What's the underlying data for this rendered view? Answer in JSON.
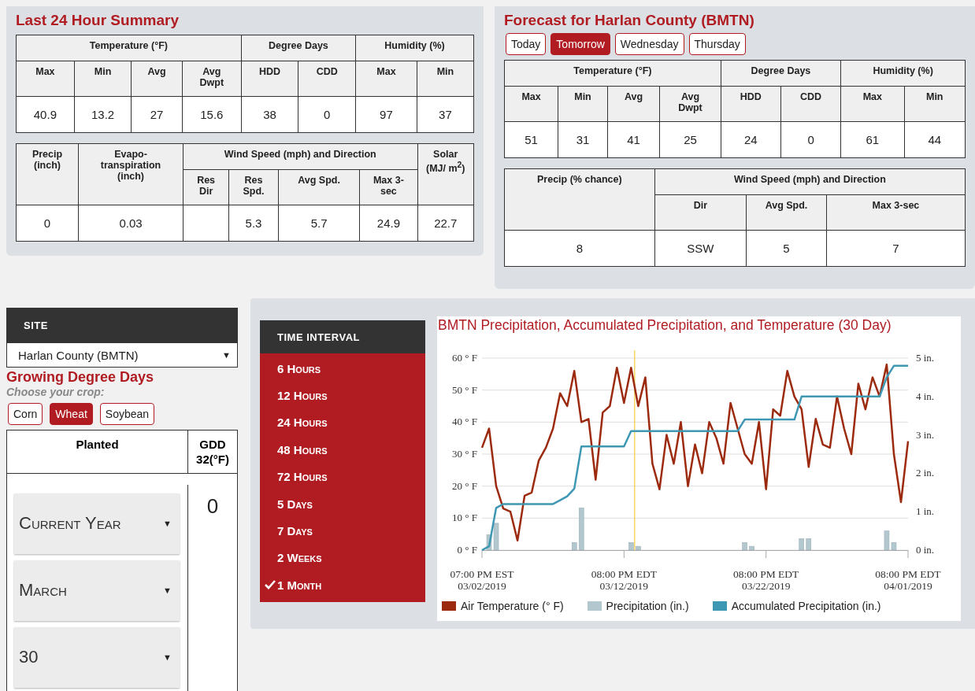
{
  "summary": {
    "title": "Last 24 Hour Summary",
    "tables": [
      {
        "groups": [
          {
            "label": "Temperature (°F)",
            "columns": [
              {
                "label": "Max",
                "value": "40.9"
              },
              {
                "label": "Min",
                "value": "13.2"
              },
              {
                "label": "Avg",
                "value": "27"
              },
              {
                "label": "Avg Dwpt",
                "value": "15.6"
              }
            ]
          },
          {
            "label": "Degree Days",
            "columns": [
              {
                "label": "HDD",
                "value": "38"
              },
              {
                "label": "CDD",
                "value": "0"
              }
            ]
          },
          {
            "label": "Humidity (%)",
            "columns": [
              {
                "label": "Max",
                "value": "97"
              },
              {
                "label": "Min",
                "value": "37"
              }
            ]
          }
        ]
      },
      {
        "groups": [
          {
            "label": "Precip (inch)",
            "value": "0"
          },
          {
            "label": "Evapo-transpiration (inch)",
            "value": "0.03"
          },
          {
            "label": "Wind Speed (mph) and Direction",
            "columns": [
              {
                "label": "Res Dir"
              },
              {
                "label": "Res Spd.",
                "value": "5.3"
              },
              {
                "label": "Avg Spd.",
                "value": "5.7"
              },
              {
                "label": "Max 3-sec",
                "value": "24.9"
              }
            ]
          },
          {
            "label": "Solar (MJ/ m$^{2}$)",
            "value": "22.7"
          }
        ]
      }
    ]
  },
  "forecast": {
    "title": "Forecast for Harlan County (BMTN)",
    "tabs": [
      {
        "label": "Today",
        "selected": false
      },
      {
        "label": "Tomorrow",
        "selected": true
      },
      {
        "label": "Wednesday",
        "selected": false
      },
      {
        "label": "Thursday",
        "selected": false
      }
    ],
    "tables": [
      {
        "groups": [
          {
            "label": "Temperature (°F)",
            "columns": [
              {
                "label": "Max",
                "value": "51"
              },
              {
                "label": "Min",
                "value": "31"
              },
              {
                "label": "Avg",
                "value": "41"
              },
              {
                "label": "Avg Dwpt",
                "value": "25"
              }
            ]
          },
          {
            "label": "Degree Days",
            "columns": [
              {
                "label": "HDD",
                "value": "24"
              },
              {
                "label": "CDD",
                "value": "0"
              }
            ]
          },
          {
            "label": "Humidity (%)",
            "columns": [
              {
                "label": "Max",
                "value": "61"
              },
              {
                "label": "Min",
                "value": "44"
              }
            ]
          }
        ]
      },
      {
        "groups": [
          {
            "label": "Precip (% chance)",
            "value": "8"
          },
          {
            "label": "Wind Speed (mph) and Direction",
            "columns": [
              {
                "label": "Dir",
                "value": "SSW"
              },
              {
                "label": "Avg Spd.",
                "value": "5"
              },
              {
                "label": "Max 3-sec",
                "value": "7"
              }
            ]
          }
        ]
      }
    ]
  },
  "site": {
    "header": "SITE",
    "value": "Harlan County (BMTN)",
    "caret": "▼"
  },
  "gdd": {
    "title": "Growing Degree Days",
    "subtitle": "Choose your crop:",
    "crops": [
      {
        "label": "Corn",
        "selected": false
      },
      {
        "label": "Wheat",
        "selected": true
      },
      {
        "label": "Soybean",
        "selected": false
      }
    ],
    "columns": [
      "Planted",
      "GDD 32(°F)"
    ],
    "selects": [
      {
        "value": "Current Year",
        "caret": "▼"
      },
      {
        "value": "March",
        "caret": "▼"
      },
      {
        "value": "30",
        "caret": "▼"
      }
    ],
    "value": "0"
  },
  "time_interval": {
    "header": "TIME INTERVAL",
    "items": [
      {
        "label": "6 Hours",
        "selected": false
      },
      {
        "label": "12 Hours",
        "selected": false
      },
      {
        "label": "24 Hours",
        "selected": false
      },
      {
        "label": "48 Hours",
        "selected": false
      },
      {
        "label": "72 Hours",
        "selected": false
      },
      {
        "label": "5 Days",
        "selected": false
      },
      {
        "label": "7 Days",
        "selected": false
      },
      {
        "label": "2 Weeks",
        "selected": false
      },
      {
        "label": "1 Month",
        "selected": true
      }
    ]
  },
  "chart": {
    "chart_data": {
      "type": "line",
      "title": "BMTN Precipitation, Accumulated Precipitation, and Temperature (30 Day)",
      "categories": [
        "07:00 PM EST 03/02/2019",
        null,
        null,
        null,
        null,
        null,
        null,
        null,
        null,
        null,
        null,
        null,
        null,
        null,
        null,
        null,
        null,
        null,
        null,
        null,
        "08:00 PM EDT 03/12/2019",
        null,
        null,
        null,
        null,
        null,
        null,
        null,
        null,
        null,
        null,
        null,
        null,
        null,
        null,
        null,
        null,
        null,
        null,
        null,
        "08:00 PM EDT 03/22/2019",
        null,
        null,
        null,
        null,
        null,
        null,
        null,
        null,
        null,
        null,
        null,
        null,
        null,
        null,
        null,
        null,
        null,
        null,
        null,
        "08:00 PM EDT 04/01/2019"
      ],
      "ylim": [
        0,
        60
      ],
      "y2lim": [
        0,
        5
      ],
      "grid": true,
      "legend": "bottom",
      "yticks": [
        {
          "value": 0,
          "label": "0 ° F"
        },
        {
          "value": 10,
          "label": "10 ° F"
        },
        {
          "value": 20,
          "label": "20 ° F"
        },
        {
          "value": 30,
          "label": "30 ° F"
        },
        {
          "value": 40,
          "label": "40 ° F"
        },
        {
          "value": 50,
          "label": "50 ° F"
        },
        {
          "value": 60,
          "label": "60 ° F"
        }
      ],
      "y2ticks": [
        {
          "value": 0,
          "label": "0 in."
        },
        {
          "value": 1,
          "label": "1 in."
        },
        {
          "value": 2,
          "label": "2 in."
        },
        {
          "value": 3,
          "label": "3 in."
        },
        {
          "value": 4,
          "label": "4 in."
        },
        {
          "value": 5,
          "label": "5 in."
        }
      ],
      "series": [
        {
          "name": "Air Temperature (° F)",
          "color": "#9c2a0e",
          "type": "line",
          "values": [
            32,
            38,
            20,
            13,
            12,
            3,
            17,
            18,
            28,
            32,
            38,
            49,
            45,
            56,
            40,
            41,
            22,
            43,
            45,
            57,
            46,
            57,
            45,
            54,
            27,
            19,
            36,
            27,
            40,
            20,
            33,
            24,
            40,
            35,
            27,
            46,
            38,
            30,
            27,
            40,
            19,
            44,
            42,
            56,
            48,
            44,
            26,
            41,
            33,
            32,
            48,
            38,
            30,
            52,
            44,
            54,
            48,
            58,
            30,
            15,
            34
          ]
        },
        {
          "name": "Precipitation (in.)",
          "color": "#b3c7cf",
          "type": "bar",
          "axis": "y2",
          "values": [
            0,
            0.4,
            0.7,
            0,
            0,
            0,
            0,
            0,
            0,
            0,
            0,
            0,
            0,
            0.2,
            1.1,
            0,
            0,
            0,
            0,
            0,
            0,
            0.2,
            0.1,
            0,
            0,
            0,
            0,
            0,
            0,
            0,
            0,
            0,
            0,
            0,
            0,
            0,
            0,
            0.2,
            0.1,
            0,
            0,
            0,
            0,
            0,
            0,
            0.3,
            0.3,
            0,
            0,
            0,
            0,
            0,
            0,
            0,
            0,
            0,
            0,
            0.5,
            0.2,
            0,
            0
          ]
        },
        {
          "name": "Accumulated Precipitation (in.)",
          "color": "#3e97b3",
          "type": "line",
          "axis": "y2",
          "values": [
            0,
            0.1,
            1.1,
            1.2,
            1.2,
            1.2,
            1.2,
            1.2,
            1.2,
            1.2,
            1.2,
            1.3,
            1.4,
            1.6,
            2.7,
            2.7,
            2.7,
            2.7,
            2.7,
            2.7,
            2.7,
            3.1,
            3.1,
            3.1,
            3.1,
            3.1,
            3.1,
            3.1,
            3.1,
            3.1,
            3.1,
            3.1,
            3.1,
            3.1,
            3.1,
            3.1,
            3.1,
            3.4,
            3.4,
            3.4,
            3.4,
            3.4,
            3.4,
            3.4,
            3.4,
            4.0,
            4.0,
            4.0,
            4.0,
            4.0,
            4.0,
            4.0,
            4.0,
            4.0,
            4.0,
            4.0,
            4.0,
            4.5,
            4.8,
            4.8,
            4.8
          ]
        }
      ]
    }
  }
}
